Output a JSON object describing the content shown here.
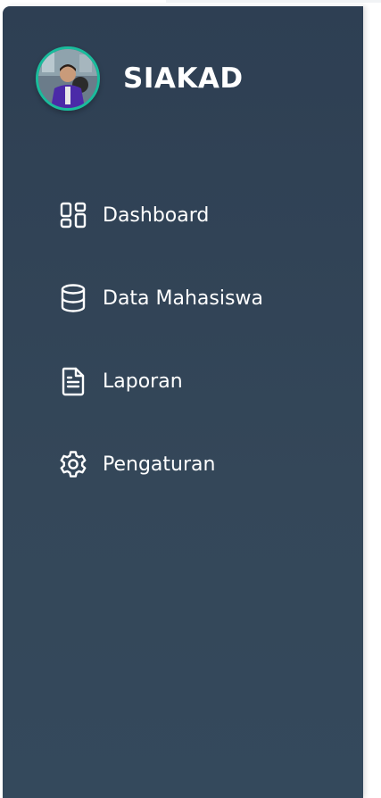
{
  "app": {
    "title": "SIAKAD",
    "avatar_icon": "user-avatar-icon"
  },
  "sidebar": {
    "items": [
      {
        "label": "Dashboard",
        "icon": "dashboard-grid-icon"
      },
      {
        "label": "Data Mahasiswa",
        "icon": "database-icon"
      },
      {
        "label": "Laporan",
        "icon": "document-icon"
      },
      {
        "label": "Pengaturan",
        "icon": "gear-icon"
      }
    ]
  },
  "colors": {
    "sidebar_bg": "#2e3f53",
    "avatar_border": "#1abc9c",
    "text": "#ffffff"
  }
}
